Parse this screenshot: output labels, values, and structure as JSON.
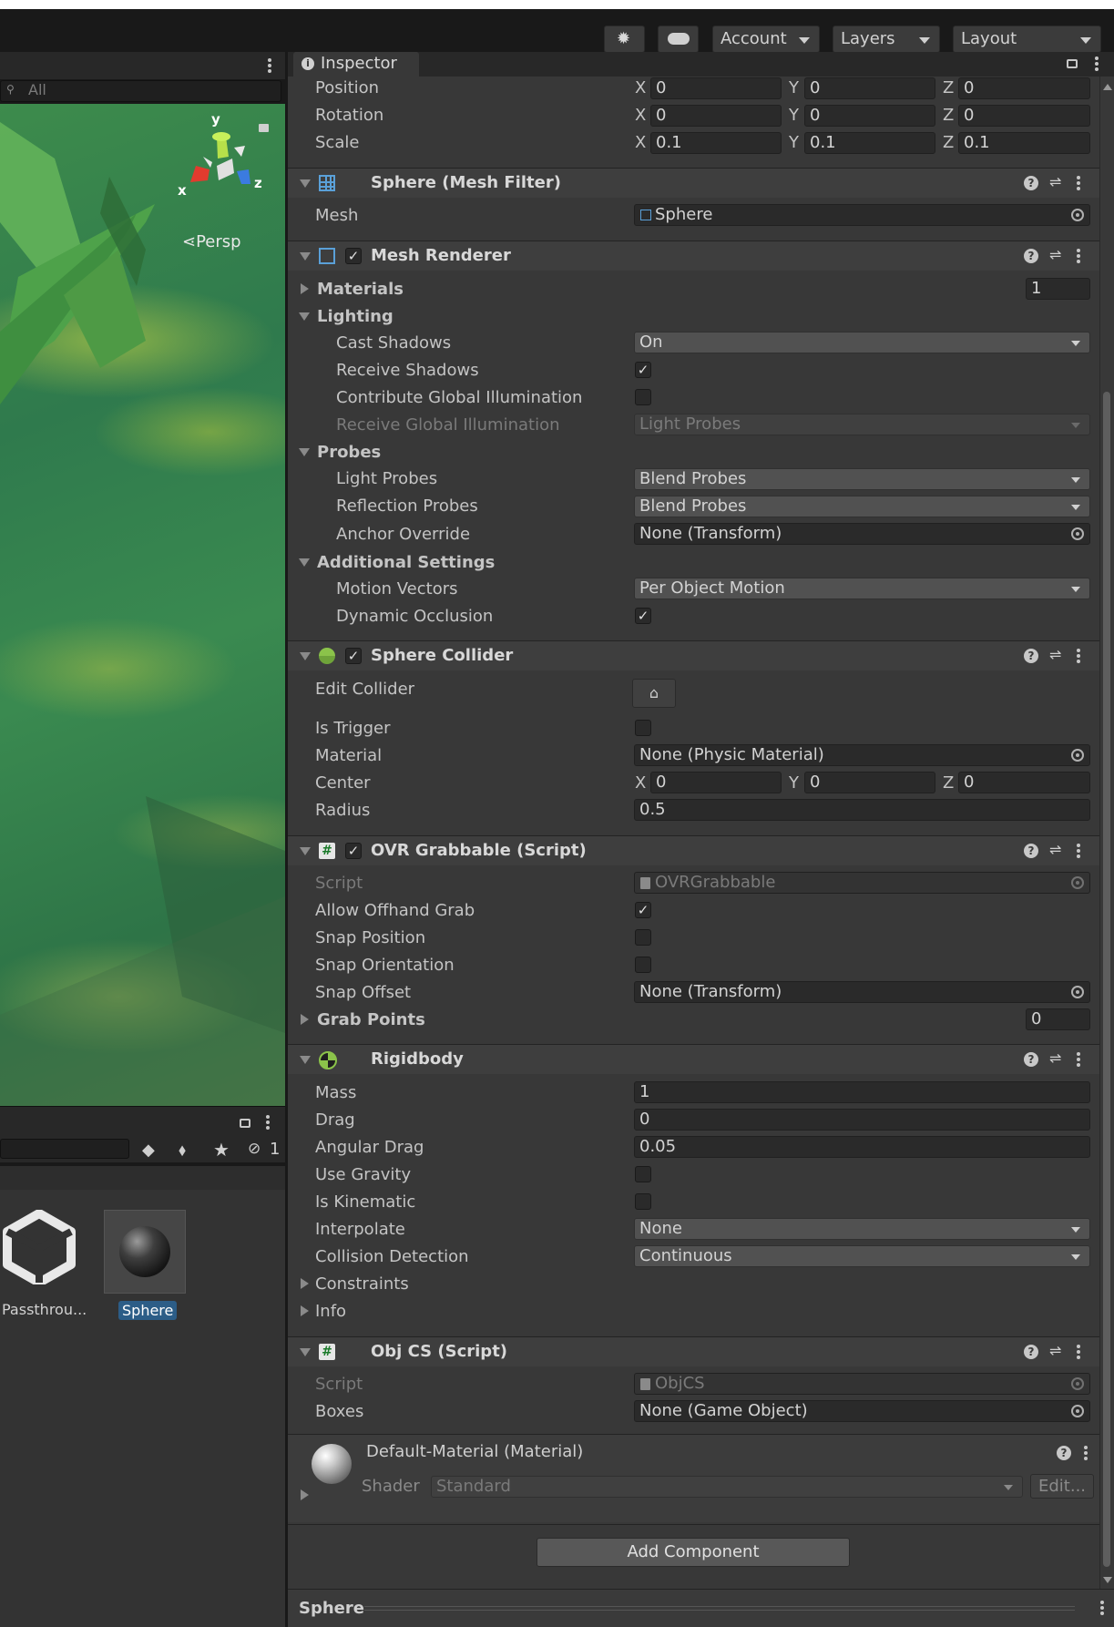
{
  "toolbar": {
    "account_label": "Account",
    "layers_label": "Layers",
    "layout_label": "Layout"
  },
  "scene": {
    "search_placeholder": "All",
    "persp_label": "Persp",
    "gizmo_x": "x",
    "gizmo_y": "y",
    "gizmo_z": "z"
  },
  "project": {
    "hidden_count": "1",
    "assets": [
      {
        "name": "Passthrou..."
      },
      {
        "name": "Sphere"
      }
    ]
  },
  "inspector": {
    "tab_label": "Inspector",
    "transform": {
      "position_label": "Position",
      "rotation_label": "Rotation",
      "scale_label": "Scale",
      "position": {
        "x": "0",
        "y": "0",
        "z": "0"
      },
      "rotation": {
        "x": "0",
        "y": "0",
        "z": "0"
      },
      "scale": {
        "x": "0.1",
        "y": "0.1",
        "z": "0.1"
      },
      "x": "X",
      "y": "Y",
      "z": "Z"
    },
    "mesh_filter": {
      "title": "Sphere (Mesh Filter)",
      "mesh_label": "Mesh",
      "mesh_value": "Sphere"
    },
    "mesh_renderer": {
      "title": "Mesh Renderer",
      "materials_label": "Materials",
      "materials_count": "1",
      "lighting_label": "Lighting",
      "cast_shadows_label": "Cast Shadows",
      "cast_shadows_value": "On",
      "receive_shadows_label": "Receive Shadows",
      "contribute_gi_label": "Contribute Global Illumination",
      "receive_gi_label": "Receive Global Illumination",
      "receive_gi_value": "Light Probes",
      "probes_label": "Probes",
      "light_probes_label": "Light Probes",
      "light_probes_value": "Blend Probes",
      "reflection_probes_label": "Reflection Probes",
      "reflection_probes_value": "Blend Probes",
      "anchor_override_label": "Anchor Override",
      "anchor_override_value": "None (Transform)",
      "additional_settings_label": "Additional Settings",
      "motion_vectors_label": "Motion Vectors",
      "motion_vectors_value": "Per Object Motion",
      "dynamic_occlusion_label": "Dynamic Occlusion"
    },
    "sphere_collider": {
      "title": "Sphere Collider",
      "edit_collider_label": "Edit Collider",
      "is_trigger_label": "Is Trigger",
      "material_label": "Material",
      "material_value": "None (Physic Material)",
      "center_label": "Center",
      "center": {
        "x": "0",
        "y": "0",
        "z": "0"
      },
      "radius_label": "Radius",
      "radius_value": "0.5"
    },
    "ovr_grabbable": {
      "title": "OVR Grabbable (Script)",
      "script_label": "Script",
      "script_value": "OVRGrabbable",
      "allow_offhand_label": "Allow Offhand Grab",
      "snap_position_label": "Snap Position",
      "snap_orientation_label": "Snap Orientation",
      "snap_offset_label": "Snap Offset",
      "snap_offset_value": "None (Transform)",
      "grab_points_label": "Grab Points",
      "grab_points_count": "0"
    },
    "rigidbody": {
      "title": "Rigidbody",
      "mass_label": "Mass",
      "mass_value": "1",
      "drag_label": "Drag",
      "drag_value": "0",
      "angular_drag_label": "Angular Drag",
      "angular_drag_value": "0.05",
      "use_gravity_label": "Use Gravity",
      "is_kinematic_label": "Is Kinematic",
      "interpolate_label": "Interpolate",
      "interpolate_value": "None",
      "collision_detection_label": "Collision Detection",
      "collision_detection_value": "Continuous",
      "constraints_label": "Constraints",
      "info_label": "Info"
    },
    "obj_cs": {
      "title": "Obj CS (Script)",
      "script_label": "Script",
      "script_value": "ObjCS",
      "boxes_label": "Boxes",
      "boxes_value": "None (Game Object)"
    },
    "material": {
      "title": "Default-Material (Material)",
      "shader_label": "Shader",
      "shader_value": "Standard",
      "edit_label": "Edit..."
    },
    "add_component_label": "Add Component",
    "footer_label": "Sphere"
  },
  "colors": {
    "selection": "#2c5d87",
    "scene_green": "#3a8a50"
  }
}
